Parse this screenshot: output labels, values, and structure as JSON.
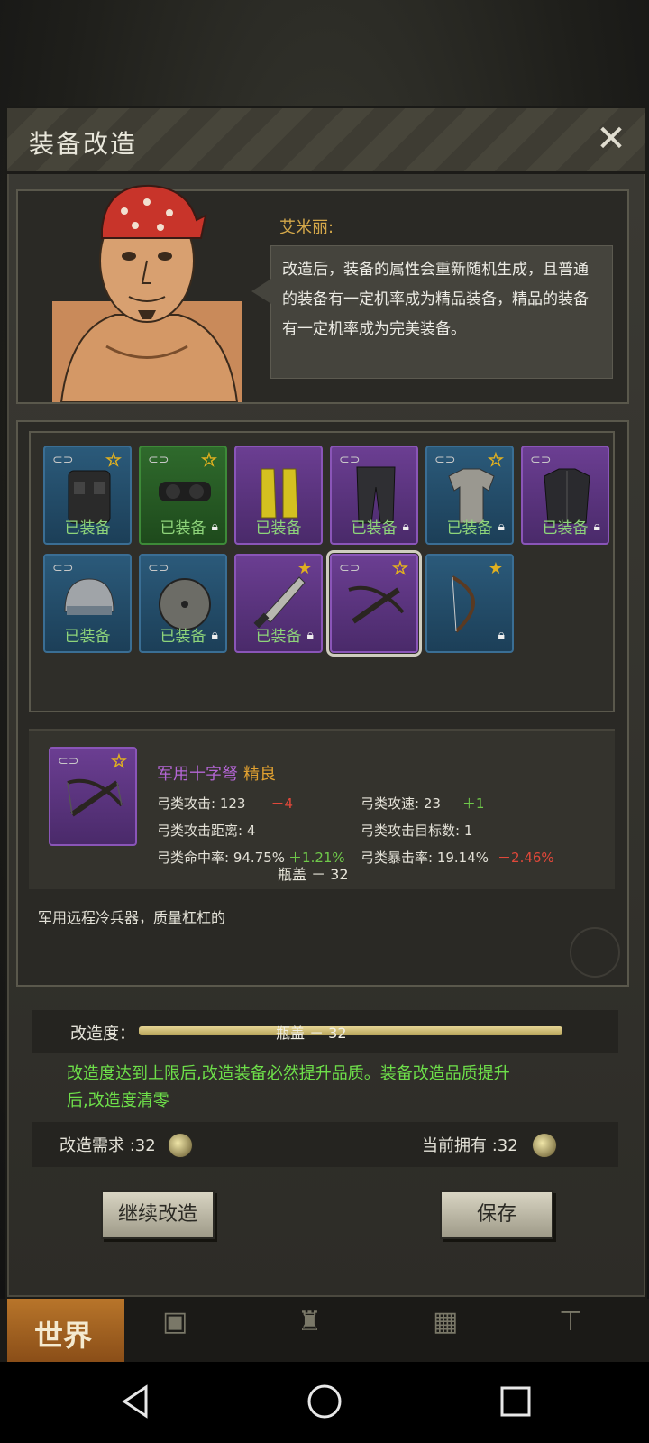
{
  "dialog": {
    "title": "装备改造",
    "close_label": "✕"
  },
  "npc": {
    "name": "艾米丽:",
    "speech": "改造后，装备的属性会重新随机生成，且普通的装备有一定机率成为精品装备，精品的装备有一定机率成为完美装备。"
  },
  "inventory": {
    "equipped_label": "已装备",
    "items": [
      {
        "name": "tactical-vest",
        "color": "blue",
        "linked": true,
        "star": "outline",
        "equipped": true,
        "locked": false
      },
      {
        "name": "night-vision-goggles",
        "color": "green",
        "linked": true,
        "star": "outline",
        "equipped": true,
        "locked": true
      },
      {
        "name": "yellow-boots",
        "color": "purple",
        "linked": false,
        "star": "none",
        "equipped": true,
        "locked": false
      },
      {
        "name": "combat-pants",
        "color": "purple",
        "linked": true,
        "star": "none",
        "equipped": true,
        "locked": true
      },
      {
        "name": "shirt",
        "color": "blue",
        "linked": true,
        "star": "outline",
        "equipped": true,
        "locked": true
      },
      {
        "name": "jacket",
        "color": "purple",
        "linked": true,
        "star": "none",
        "equipped": true,
        "locked": true
      },
      {
        "name": "helmet",
        "color": "blue",
        "linked": true,
        "star": "none",
        "equipped": true,
        "locked": false
      },
      {
        "name": "round-shield",
        "color": "blue",
        "linked": true,
        "star": "none",
        "equipped": true,
        "locked": true
      },
      {
        "name": "machete",
        "color": "purple",
        "linked": false,
        "star": "filled",
        "equipped": true,
        "locked": true
      },
      {
        "name": "crossbow",
        "color": "purple",
        "linked": true,
        "star": "outline",
        "equipped": false,
        "locked": false,
        "selected": true
      },
      {
        "name": "recurve-bow",
        "color": "blue",
        "linked": false,
        "star": "filled",
        "equipped": false,
        "locked": true
      }
    ]
  },
  "detail": {
    "name": "军用十字弩",
    "quality": "精良",
    "stats": {
      "attack": {
        "label": "弓类攻击: 123",
        "delta": "－4"
      },
      "speed": {
        "label": "弓类攻速: 23",
        "delta": "＋1"
      },
      "range": {
        "label": "弓类攻击距离: 4"
      },
      "targets": {
        "label": "弓类攻击目标数: 1"
      },
      "hit": {
        "label": "弓类命中率: 94.75%",
        "delta": "＋1.21%"
      },
      "crit": {
        "label": "弓类暴击率: 19.14%",
        "delta": "－2.46%"
      }
    },
    "overlay_caps": "瓶盖 － 32",
    "description": "军用远程冷兵器，质量杠杠的"
  },
  "modification": {
    "label": "改造度：",
    "bar_text": "瓶盖 － 32",
    "progress": 1.0,
    "info": "改造度达到上限后,改造装备必然提升品质。装备改造品质提升后,改造度清零"
  },
  "requirement": {
    "need_label": "改造需求 :32",
    "owned_label": "当前拥有 :32"
  },
  "buttons": {
    "continue": "继续改造",
    "save": "保存"
  },
  "nav": {
    "world": "世界"
  },
  "colors": {
    "blue_slot": "#2b5a7a",
    "green_slot": "#2f6a2c",
    "purple_slot": "#6b3e92",
    "equipped_text": "#8ed47a",
    "negative": "#e0483a",
    "positive": "#6fc94a",
    "quality": "#e0a030",
    "info_text": "#6ee04a"
  }
}
